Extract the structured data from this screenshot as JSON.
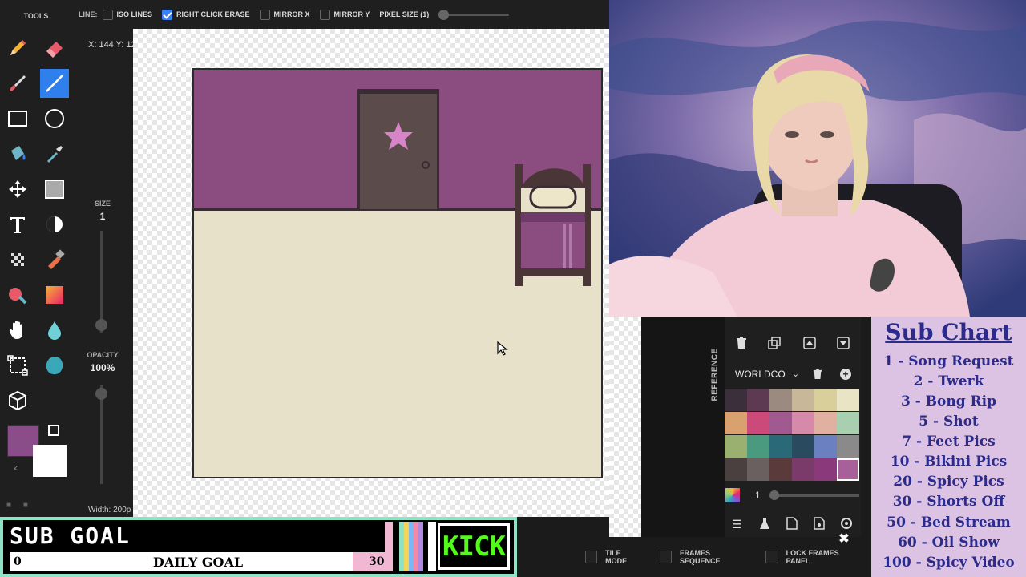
{
  "toolbar": {
    "line_label": "LINE:",
    "iso_lines": "ISO LINES",
    "right_click_erase": "RIGHT CLICK ERASE",
    "mirror_x": "MIRROR X",
    "mirror_y": "MIRROR Y",
    "pixel_size": "PIXEL SIZE (1)"
  },
  "tools_panel": {
    "title": "TOOLS"
  },
  "side": {
    "coords": "X: 144 Y: 12",
    "size_label": "SIZE",
    "size_value": "1",
    "opacity_label": "OPACITY",
    "opacity_value": "100%",
    "width_text": "Width: 200p"
  },
  "colors": {
    "primary": "#8b4c8a",
    "secondary": "#ffffff",
    "wall": "#8b4c7f",
    "floor": "#e7e1c9",
    "door": "#5c4b4b",
    "accent_blue": "#2f80ed"
  },
  "reference": {
    "tab_label": "REFERENCE",
    "palette_name": "WORLDCO",
    "opacity_value": "1",
    "swatches": [
      "#3a2f3a",
      "#5e3a52",
      "#9a8a80",
      "#c9b79a",
      "#d9cf9a",
      "#e8e4c4",
      "#d9a070",
      "#cc4a7a",
      "#a05a90",
      "#d48aa8",
      "#e0b0a0",
      "#a8d0b0",
      "#9ab070",
      "#4a9a80",
      "#2a6a78",
      "#2a4a60",
      "#6a80c0",
      "#8a8a8a",
      "#4a4040",
      "#6a6060",
      "#5a3a3a",
      "#7a3a6a",
      "#8a3a7a",
      "#a8609a"
    ]
  },
  "bottom_options": {
    "tile_mode": "TILE MODE",
    "frames_sequence": "FRAMES SEQUENCE",
    "lock_frames_panel": "LOCK FRAMES PANEL"
  },
  "sub_chart": {
    "title": "Sub Chart",
    "items": [
      "1 - Song Request",
      "2 - Twerk",
      "3 - Bong Rip",
      "5 - Shot",
      "7 - Feet Pics",
      "10 - Bikini Pics",
      "20 - Spicy Pics",
      "30 - Shorts Off",
      "50 - Bed Stream",
      "60 - Oil Show",
      "100 - Spicy Video"
    ]
  },
  "sub_goal": {
    "title": "SUB GOAL",
    "current": "0",
    "label": "DAILY GOAL",
    "target": "30",
    "kick": "KICK"
  }
}
